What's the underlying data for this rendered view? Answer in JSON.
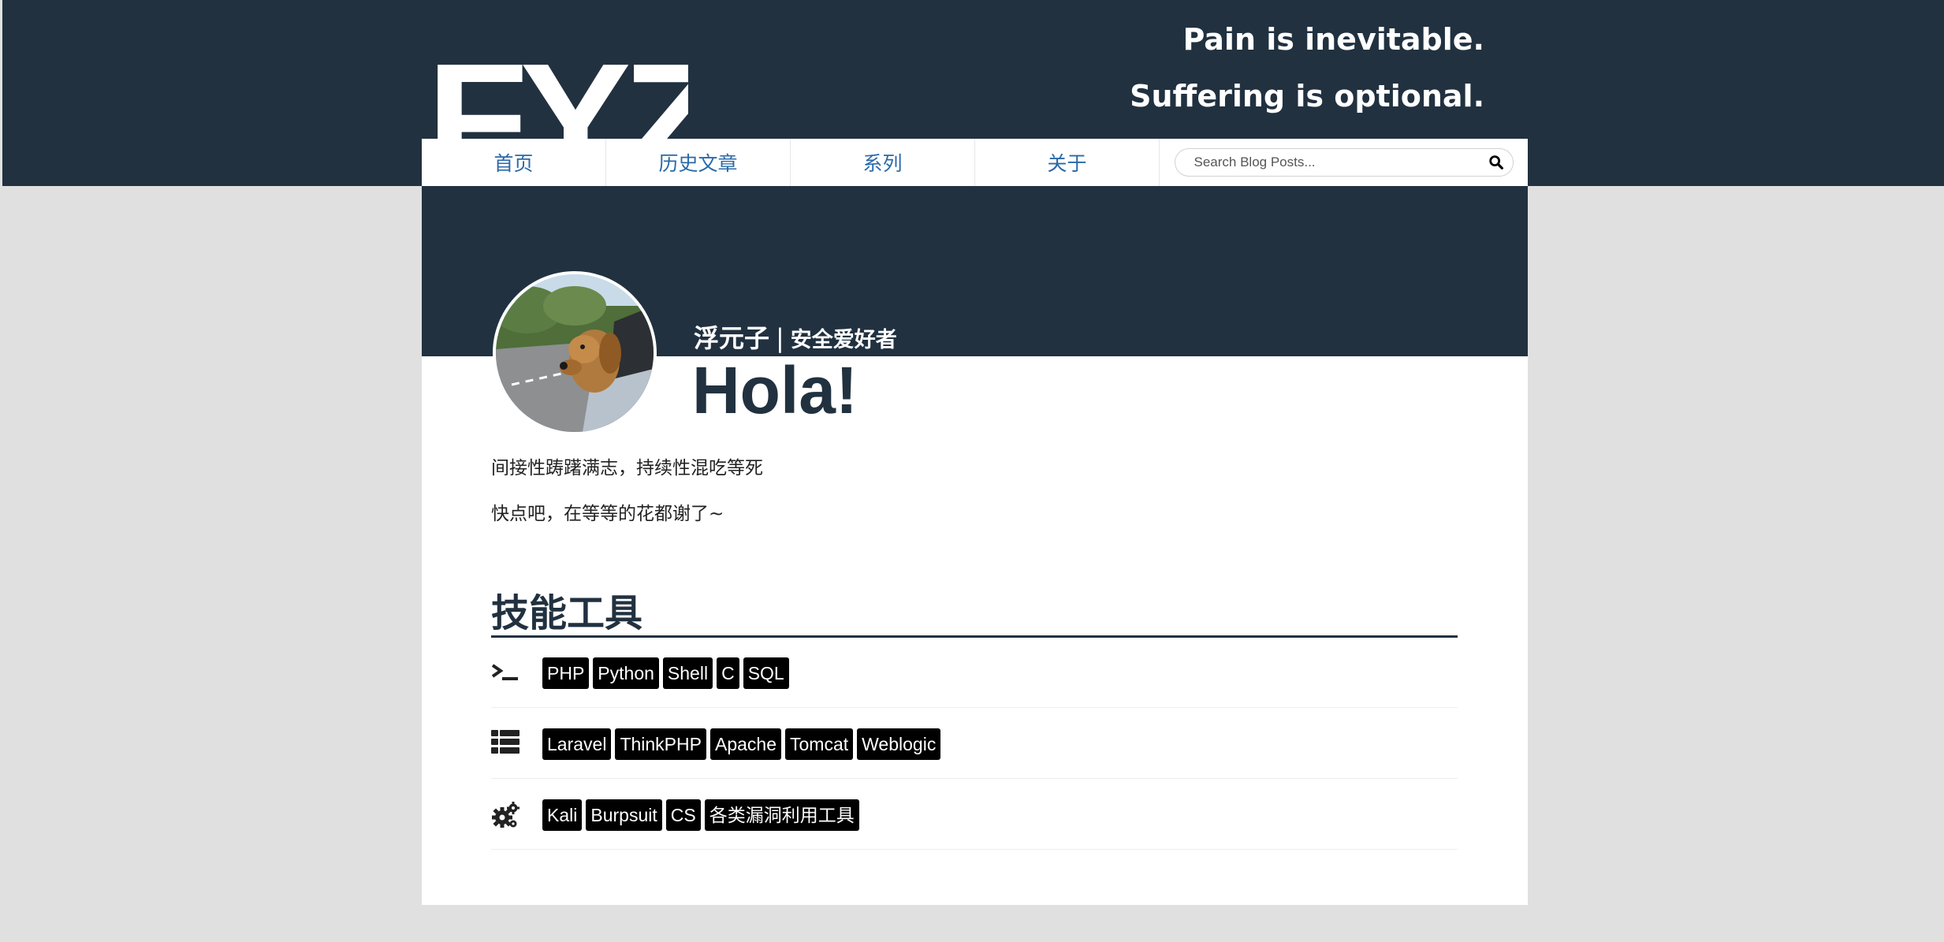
{
  "header": {
    "logo_text": "FYZ",
    "motto_line1": "Pain is inevitable.",
    "motto_line2": "Suffering is optional."
  },
  "nav": {
    "items": [
      {
        "label": "首页"
      },
      {
        "label": "历史文章"
      },
      {
        "label": "系列"
      },
      {
        "label": "关于"
      }
    ],
    "search_placeholder": "Search Blog Posts..."
  },
  "profile": {
    "name": "浮元子",
    "separator": "|",
    "role": "安全爱好者",
    "greeting": "Hola!",
    "bio_line1": "间接性踌躇满志，持续性混吃等死",
    "bio_line2": "快点吧，在等等的花都谢了~"
  },
  "skills": {
    "title": "技能工具",
    "rows": [
      {
        "icon": "terminal-icon",
        "tags": [
          "PHP",
          "Python",
          "Shell",
          "C",
          "SQL"
        ]
      },
      {
        "icon": "list-icon",
        "tags": [
          "Laravel",
          "ThinkPHP",
          "Apache",
          "Tomcat",
          "Weblogic"
        ]
      },
      {
        "icon": "gears-icon",
        "tags": [
          "Kali",
          "Burpsuit",
          "CS",
          "各类漏洞利用工具"
        ]
      }
    ]
  },
  "colors": {
    "header_bg": "#213140",
    "nav_link": "#2a69a8",
    "page_bg": "#e0e0e0",
    "tag_bg": "#000000"
  }
}
